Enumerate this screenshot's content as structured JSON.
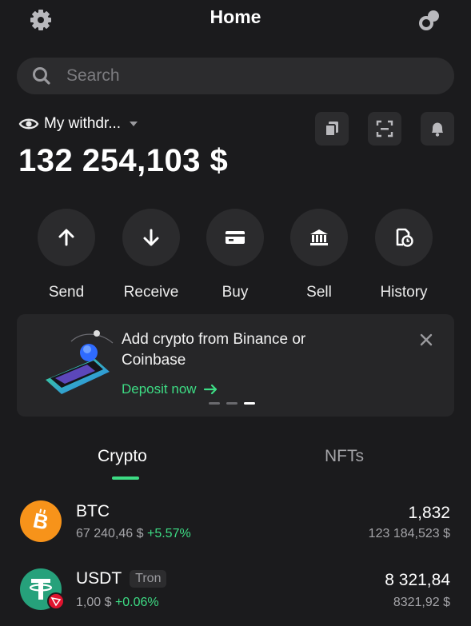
{
  "header": {
    "title": "Home"
  },
  "search": {
    "placeholder": "Search"
  },
  "wallet": {
    "name": "My withdr...",
    "balance": "132 254,103 $"
  },
  "actions": [
    {
      "label": "Send",
      "icon": "arrow-up-icon"
    },
    {
      "label": "Receive",
      "icon": "arrow-down-icon"
    },
    {
      "label": "Buy",
      "icon": "card-icon"
    },
    {
      "label": "Sell",
      "icon": "bank-icon"
    },
    {
      "label": "History",
      "icon": "history-icon"
    }
  ],
  "promo": {
    "text": "Add crypto from Binance or Coinbase",
    "link": "Deposit now"
  },
  "tabs": [
    {
      "label": "Crypto",
      "active": true
    },
    {
      "label": "NFTs",
      "active": false
    }
  ],
  "assets": [
    {
      "symbol": "BTC",
      "price": "67 240,46 $",
      "change": "+5.57%",
      "amount": "1,832",
      "fiat": "123 184,523 $",
      "network": "",
      "icon": "btc-icon",
      "color": "#f7931a"
    },
    {
      "symbol": "USDT",
      "price": "1,00 $",
      "change": "+0.06%",
      "amount": "8 321,84",
      "fiat": "8321,92 $",
      "network": "Tron",
      "icon": "usdt-icon",
      "color": "#26a17b"
    }
  ],
  "colors": {
    "accent": "#3ddc84",
    "background": "#1b1b1d",
    "surface": "#2c2c2e"
  }
}
